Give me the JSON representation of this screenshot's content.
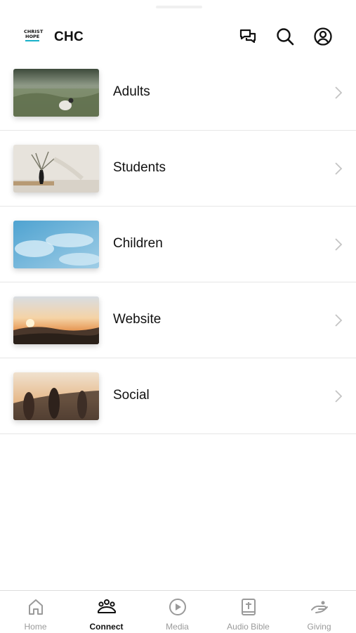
{
  "header": {
    "logo_line1": "CHRIST",
    "logo_line2": "HOPE",
    "title": "CHC",
    "icons": [
      "chat-icon",
      "search-icon",
      "profile-icon"
    ]
  },
  "list": {
    "items": [
      {
        "label": "Adults",
        "image": "grass-field-photo"
      },
      {
        "label": "Students",
        "image": "vase-plant-photo"
      },
      {
        "label": "Children",
        "image": "sky-clouds-photo"
      },
      {
        "label": "Website",
        "image": "sunset-mountains-photo"
      },
      {
        "label": "Social",
        "image": "people-hillside-photo"
      }
    ]
  },
  "tabbar": {
    "tabs": [
      {
        "label": "Home",
        "icon": "home-icon"
      },
      {
        "label": "Connect",
        "icon": "people-icon"
      },
      {
        "label": "Media",
        "icon": "play-icon"
      },
      {
        "label": "Audio Bible",
        "icon": "bible-icon"
      },
      {
        "label": "Giving",
        "icon": "giving-hand-icon"
      }
    ],
    "active": "Connect"
  },
  "colors": {
    "accent": "#19b1c9",
    "text": "#111111",
    "inactive": "#9a9a9a",
    "divider": "#e6e6e6"
  }
}
